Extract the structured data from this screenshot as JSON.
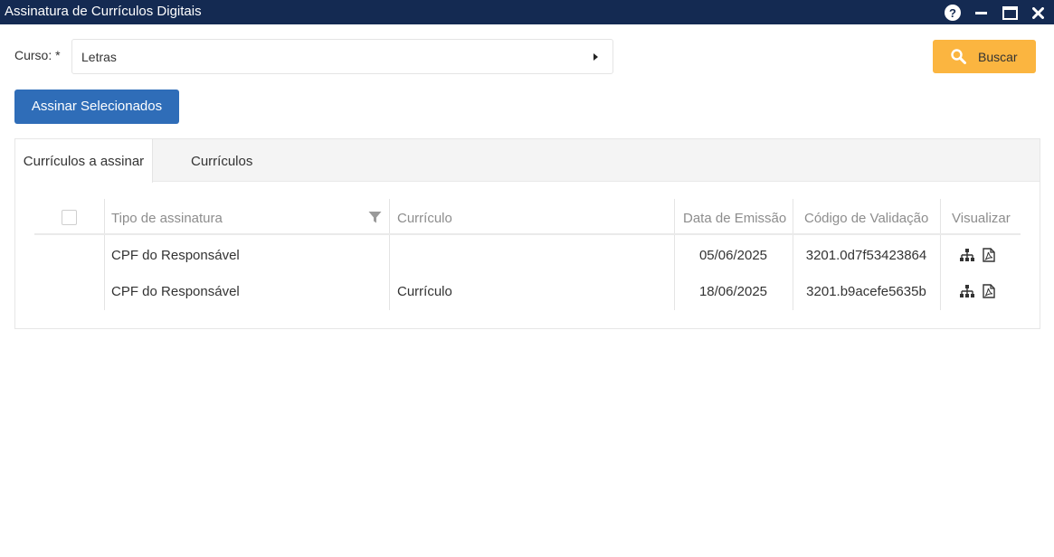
{
  "window": {
    "title": "Assinatura de Currículos Digitais",
    "help_label": "?"
  },
  "filter": {
    "curso_label": "Curso: *",
    "curso_value": "Letras",
    "buscar_label": "Buscar"
  },
  "actions": {
    "assinar_label": "Assinar Selecionados"
  },
  "tabs": [
    {
      "label": "Currículos a assinar",
      "active": true
    },
    {
      "label": "Currículos",
      "active": false
    }
  ],
  "table": {
    "columns": [
      "Tipo de assinatura",
      "Currículo",
      "Data de Emissão",
      "Código de Validação",
      "Visualizar"
    ],
    "rows": [
      {
        "tipo": "CPF do Responsável",
        "curriculo": "",
        "data": "05/06/2025",
        "codigo": "3201.0d7f53423864"
      },
      {
        "tipo": "CPF do Responsável",
        "curriculo": "Currículo",
        "data": "18/06/2025",
        "codigo": "3201.b9acefe5635b"
      }
    ]
  },
  "colors": {
    "titlebar": "#142a52",
    "primary_button": "#2f6db8",
    "search_button": "#fbb540"
  },
  "icons": [
    "help-icon",
    "minimize-icon",
    "maximize-icon",
    "close-icon",
    "caret-right-icon",
    "search-icon",
    "filter-icon",
    "hierarchy-icon",
    "pdf-icon"
  ]
}
